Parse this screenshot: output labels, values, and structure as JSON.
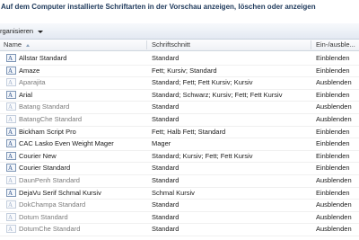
{
  "header": {
    "text": "Auf dem Computer installierte Schriftarten in der Vorschau anzeigen, löschen oder anzeigen"
  },
  "toolbar": {
    "organize_label": "rganisieren"
  },
  "columns": {
    "name": "Name",
    "style": "Schriftschnitt",
    "visibility": "Ein-/ausble..."
  },
  "icons": {
    "font_file": "font-file-icon"
  },
  "fonts": [
    {
      "name": "Allstar Standard",
      "style": "Standard",
      "visibility": "Einblenden",
      "dim": false
    },
    {
      "name": "Amaze",
      "style": "Fett; Kursiv; Standard",
      "visibility": "Einblenden",
      "dim": false
    },
    {
      "name": "Aparajita",
      "style": "Standard; Fett; Fett Kursiv; Kursiv",
      "visibility": "Ausblenden",
      "dim": true
    },
    {
      "name": "Arial",
      "style": "Standard; Schwarz; Kursiv; Fett; Fett Kursiv",
      "visibility": "Einblenden",
      "dim": false
    },
    {
      "name": "Batang Standard",
      "style": "Standard",
      "visibility": "Ausblenden",
      "dim": true
    },
    {
      "name": "BatangChe Standard",
      "style": "Standard",
      "visibility": "Ausblenden",
      "dim": true
    },
    {
      "name": "Bickham Script Pro",
      "style": "Fett; Halb Fett; Standard",
      "visibility": "Einblenden",
      "dim": false
    },
    {
      "name": "CAC Lasko Even Weight Mager",
      "style": "Mager",
      "visibility": "Einblenden",
      "dim": false
    },
    {
      "name": "Courier New",
      "style": "Standard; Kursiv; Fett; Fett Kursiv",
      "visibility": "Einblenden",
      "dim": false
    },
    {
      "name": "Courier Standard",
      "style": "Standard",
      "visibility": "Einblenden",
      "dim": false
    },
    {
      "name": "DaunPenh Standard",
      "style": "Standard",
      "visibility": "Ausblenden",
      "dim": true
    },
    {
      "name": "DejaVu Serif Schmal Kursiv",
      "style": "Schmal Kursiv",
      "visibility": "Einblenden",
      "dim": false
    },
    {
      "name": "DokChampa Standard",
      "style": "Standard",
      "visibility": "Ausblenden",
      "dim": true
    },
    {
      "name": "Dotum Standard",
      "style": "Standard",
      "visibility": "Ausblenden",
      "dim": true
    },
    {
      "name": "DotumChe Standard",
      "style": "Standard",
      "visibility": "Ausblenden",
      "dim": true
    }
  ]
}
